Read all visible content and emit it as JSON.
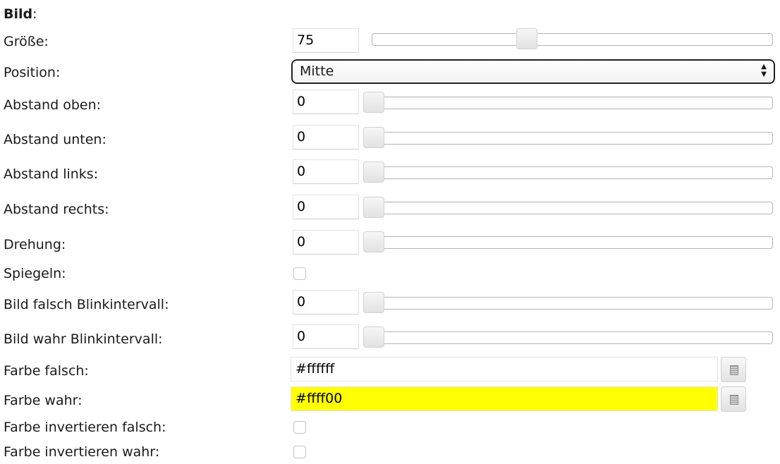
{
  "section": {
    "title": "Bild",
    "colon": ":"
  },
  "groesse": {
    "label": "Größe:",
    "value": "75",
    "slider": 0.38
  },
  "position": {
    "label": "Position:",
    "selected": "Mitte"
  },
  "sliders": [
    {
      "key": "abstand-oben",
      "label": "Abstand oben:",
      "value": "0",
      "level": 0
    },
    {
      "key": "abstand-unten",
      "label": "Abstand unten:",
      "value": "0",
      "level": 0
    },
    {
      "key": "abstand-links",
      "label": "Abstand links:",
      "value": "0",
      "level": 0
    },
    {
      "key": "abstand-rechts",
      "label": "Abstand rechts:",
      "value": "0",
      "level": 0
    },
    {
      "key": "drehung",
      "label": "Drehung:",
      "value": "0",
      "level": 0
    }
  ],
  "spiegeln": {
    "label": "Spiegeln:",
    "checked": false
  },
  "blink": [
    {
      "key": "bild-falsch-blinkintervall",
      "label": "Bild falsch Blinkintervall:",
      "value": "0",
      "level": 0
    },
    {
      "key": "bild-wahr-blinkintervall",
      "label": "Bild wahr Blinkintervall:",
      "value": "0",
      "level": 0
    }
  ],
  "farbe_falsch": {
    "label": "Farbe falsch:",
    "value": "#ffffff",
    "color": "#ffffff"
  },
  "farbe_wahr": {
    "label": "Farbe wahr:",
    "value": "#ffff00",
    "color": "#ffff00"
  },
  "invert_falsch": {
    "label": "Farbe invertieren falsch:",
    "checked": false
  },
  "invert_wahr": {
    "label": "Farbe invertieren wahr:",
    "checked": false
  }
}
